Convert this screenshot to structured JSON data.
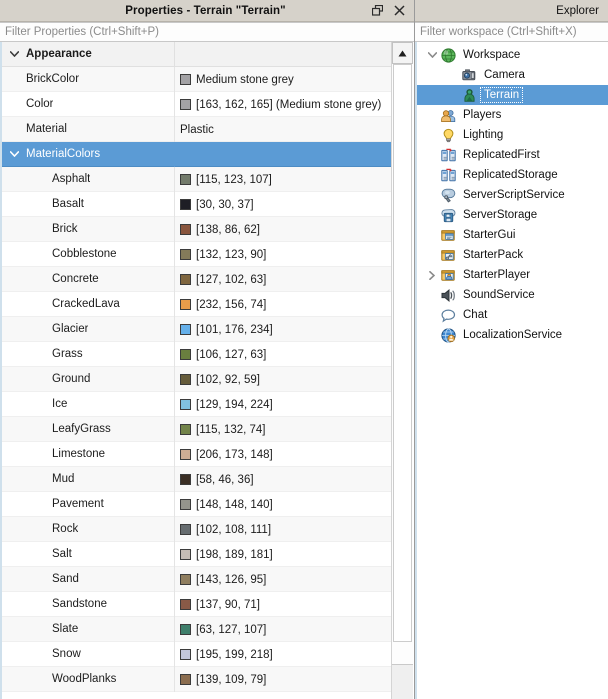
{
  "properties_panel": {
    "title": "Properties - Terrain \"Terrain\"",
    "window_buttons": [
      {
        "name": "restore-button",
        "glyph": "restore"
      },
      {
        "name": "close-button",
        "glyph": "close"
      }
    ],
    "filter": {
      "placeholder": "Filter Properties (Ctrl+Shift+P)",
      "value": ""
    },
    "selection_color": "#5b9bd5",
    "rows": [
      {
        "kind": "group",
        "name": "Appearance",
        "expanded": true,
        "value": "",
        "swatch": null
      },
      {
        "kind": "prop",
        "name": "BrickColor",
        "value": "Medium stone grey",
        "swatch": "#a3a2a5"
      },
      {
        "kind": "prop",
        "name": "Color",
        "value": "[163, 162, 165] (Medium stone grey)",
        "swatch": "#a3a2a5"
      },
      {
        "kind": "prop",
        "name": "Material",
        "value": "Plastic",
        "swatch": null
      },
      {
        "kind": "group2",
        "name": "MaterialColors",
        "expanded": true,
        "value": "",
        "swatch": null,
        "selected": true
      },
      {
        "kind": "sub",
        "name": "Asphalt",
        "value": "[115, 123, 107]",
        "swatch": "#737b6b"
      },
      {
        "kind": "sub",
        "name": "Basalt",
        "value": "[30, 30, 37]",
        "swatch": "#1e1e25"
      },
      {
        "kind": "sub",
        "name": "Brick",
        "value": "[138, 86, 62]",
        "swatch": "#8a563e"
      },
      {
        "kind": "sub",
        "name": "Cobblestone",
        "value": "[132, 123, 90]",
        "swatch": "#847b5a"
      },
      {
        "kind": "sub",
        "name": "Concrete",
        "value": "[127, 102, 63]",
        "swatch": "#7f663f"
      },
      {
        "kind": "sub",
        "name": "CrackedLava",
        "value": "[232, 156, 74]",
        "swatch": "#e89c4a"
      },
      {
        "kind": "sub",
        "name": "Glacier",
        "value": "[101, 176, 234]",
        "swatch": "#65b0ea"
      },
      {
        "kind": "sub",
        "name": "Grass",
        "value": "[106, 127, 63]",
        "swatch": "#6a7f3f"
      },
      {
        "kind": "sub",
        "name": "Ground",
        "value": "[102, 92, 59]",
        "swatch": "#665c3b"
      },
      {
        "kind": "sub",
        "name": "Ice",
        "value": "[129, 194, 224]",
        "swatch": "#81c2e0"
      },
      {
        "kind": "sub",
        "name": "LeafyGrass",
        "value": "[115, 132, 74]",
        "swatch": "#73844a"
      },
      {
        "kind": "sub",
        "name": "Limestone",
        "value": "[206, 173, 148]",
        "swatch": "#cead94"
      },
      {
        "kind": "sub",
        "name": "Mud",
        "value": "[58, 46, 36]",
        "swatch": "#3a2e24"
      },
      {
        "kind": "sub",
        "name": "Pavement",
        "value": "[148, 148, 140]",
        "swatch": "#94948c"
      },
      {
        "kind": "sub",
        "name": "Rock",
        "value": "[102, 108, 111]",
        "swatch": "#666c6f"
      },
      {
        "kind": "sub",
        "name": "Salt",
        "value": "[198, 189, 181]",
        "swatch": "#c6bdb5"
      },
      {
        "kind": "sub",
        "name": "Sand",
        "value": "[143, 126, 95]",
        "swatch": "#8f7e5f"
      },
      {
        "kind": "sub",
        "name": "Sandstone",
        "value": "[137, 90, 71]",
        "swatch": "#895a47"
      },
      {
        "kind": "sub",
        "name": "Slate",
        "value": "[63, 127, 107]",
        "swatch": "#3f7f6b"
      },
      {
        "kind": "sub",
        "name": "Snow",
        "value": "[195, 199, 218]",
        "swatch": "#c3c7da"
      },
      {
        "kind": "sub",
        "name": "WoodPlanks",
        "value": "[139, 109, 79]",
        "swatch": "#8b6d4f"
      }
    ]
  },
  "explorer_panel": {
    "title": "Explorer",
    "filter": {
      "placeholder": "Filter workspace (Ctrl+Shift+X)",
      "value": ""
    },
    "items": [
      {
        "label": "Workspace",
        "icon": "globe-icon",
        "depth": 0,
        "chevron": "expanded",
        "selected": false
      },
      {
        "label": "Camera",
        "icon": "camera-icon",
        "depth": 1,
        "chevron": "none",
        "selected": false
      },
      {
        "label": "Terrain",
        "icon": "terrain-icon",
        "depth": 1,
        "chevron": "none",
        "selected": true
      },
      {
        "label": "Players",
        "icon": "players-icon",
        "depth": 0,
        "chevron": "none",
        "selected": false
      },
      {
        "label": "Lighting",
        "icon": "lightbulb-icon",
        "depth": 0,
        "chevron": "none",
        "selected": false
      },
      {
        "label": "ReplicatedFirst",
        "icon": "replicate-icon",
        "depth": 0,
        "chevron": "none",
        "selected": false
      },
      {
        "label": "ReplicatedStorage",
        "icon": "replicate-icon",
        "depth": 0,
        "chevron": "none",
        "selected": false
      },
      {
        "label": "ServerScriptService",
        "icon": "script-service-icon",
        "depth": 0,
        "chevron": "none",
        "selected": false
      },
      {
        "label": "ServerStorage",
        "icon": "server-storage-icon",
        "depth": 0,
        "chevron": "none",
        "selected": false
      },
      {
        "label": "StarterGui",
        "icon": "starter-gui-icon",
        "depth": 0,
        "chevron": "none",
        "selected": false
      },
      {
        "label": "StarterPack",
        "icon": "starter-pack-icon",
        "depth": 0,
        "chevron": "none",
        "selected": false
      },
      {
        "label": "StarterPlayer",
        "icon": "starter-player-icon",
        "depth": 0,
        "chevron": "collapsed",
        "selected": false
      },
      {
        "label": "SoundService",
        "icon": "speaker-icon",
        "depth": 0,
        "chevron": "none",
        "selected": false
      },
      {
        "label": "Chat",
        "icon": "chat-bubble-icon",
        "depth": 0,
        "chevron": "none",
        "selected": false
      },
      {
        "label": "LocalizationService",
        "icon": "localization-icon",
        "depth": 0,
        "chevron": "none",
        "selected": false
      }
    ]
  }
}
